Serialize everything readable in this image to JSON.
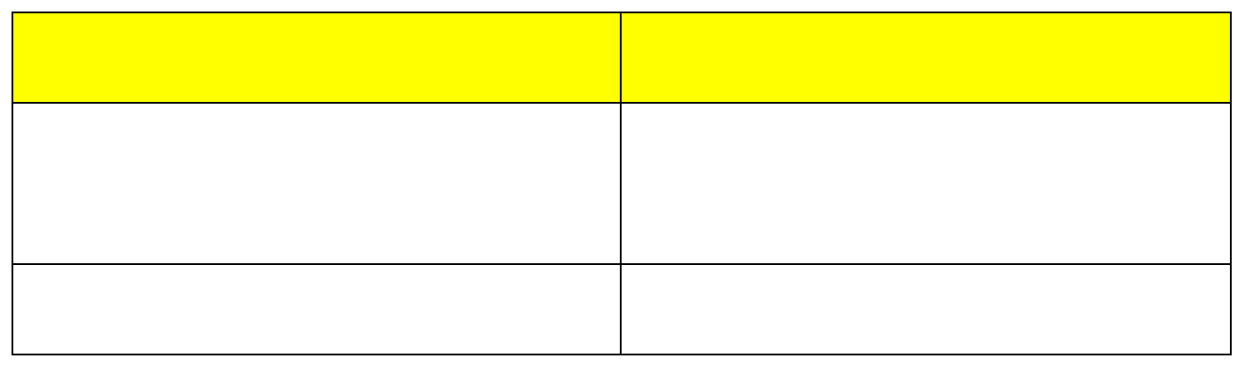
{
  "colors": {
    "header_fill": "#ffff00",
    "border": "#000000",
    "background": "#ffffff"
  },
  "table": {
    "header": [
      "",
      ""
    ],
    "rows": [
      [
        "",
        ""
      ],
      [
        "",
        ""
      ]
    ]
  }
}
